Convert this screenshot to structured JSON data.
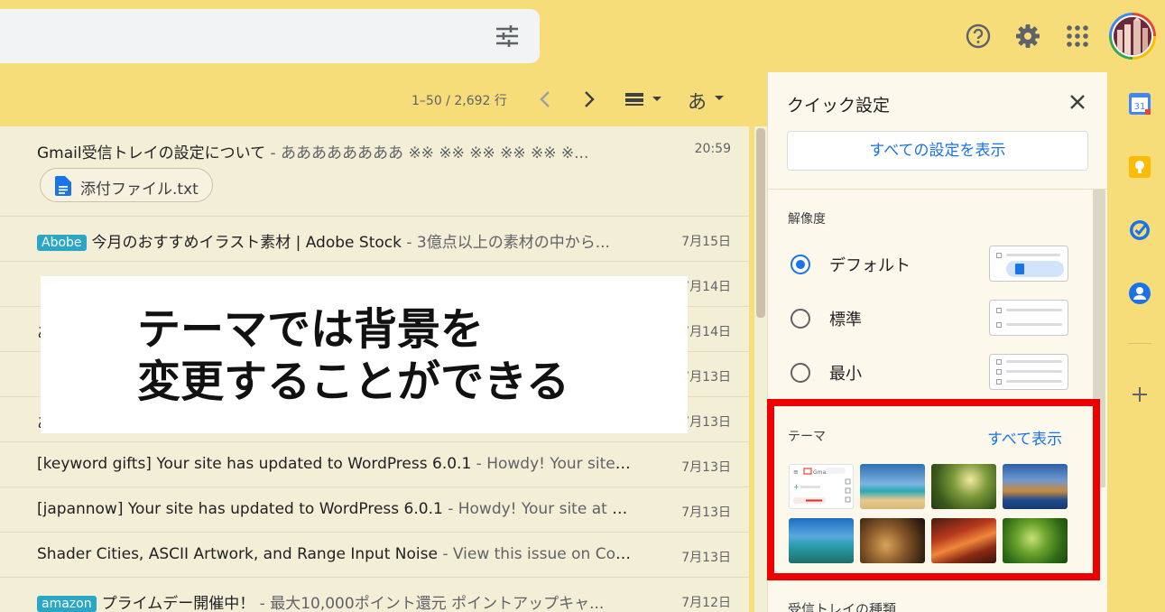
{
  "search": {
    "placeholder": "",
    "options_icon": "tune-icon"
  },
  "header_icons": [
    "help-icon",
    "settings-gear-icon",
    "apps-grid-icon",
    "account-avatar"
  ],
  "toolbar": {
    "pagination": "1–50 / 2,692 行",
    "input_tools_label": "あ"
  },
  "mails": [
    {
      "label": "",
      "subject": "Gmail受信トレイの設定について",
      "snippet": " - ああああああああ ※※ ※※ ※※ ※※ ※※ ※...",
      "date": "20:59",
      "attachment": "添付ファイル.txt"
    },
    {
      "label": "Abobe",
      "subject": "今月のおすすめイラスト素材 | Adobe Stock",
      "snippet": " - 3億点以上の素材の中から...",
      "date": "7月15日"
    },
    {
      "label": "",
      "subject": "",
      "snippet": "",
      "date": "7月14日"
    },
    {
      "label": "",
      "subject": "あ",
      "snippet": "",
      "date": "7月14日"
    },
    {
      "label": "",
      "subject": "",
      "snippet": "",
      "date": "7月13日"
    },
    {
      "label": "",
      "subject": "あ",
      "snippet": "",
      "date": "7月13日"
    },
    {
      "label": "",
      "subject": "[keyword gifts] Your site has updated to WordPress 6.0.1",
      "snippet": " - Howdy! Your site at h...",
      "date": "7月13日"
    },
    {
      "label": "",
      "subject": "[japannow] Your site has updated to WordPress 6.0.1",
      "snippet": " - Howdy! Your site at http:/...",
      "date": "7月13日"
    },
    {
      "label": "",
      "subject": "Shader Cities, ASCII Artwork, and Range Input Noise",
      "snippet": " - View this issue on CodeP...",
      "date": "7月13日"
    },
    {
      "label": "amazon",
      "subject": "プライムデー開催中！",
      "snippet": " - 最大10,000ポイント還元 ポイントアップキャ...",
      "date": "7月12日"
    }
  ],
  "caption": {
    "text": "テーマでは背景を\n変更することができる"
  },
  "quick_settings": {
    "title": "クイック設定",
    "all_settings_button": "すべての設定を表示",
    "density_title": "解像度",
    "density_options": [
      {
        "label": "デフォルト",
        "selected": true
      },
      {
        "label": "標準",
        "selected": false
      },
      {
        "label": "最小",
        "selected": false
      }
    ],
    "theme_title": "テーマ",
    "theme_view_all": "すべて表示",
    "theme_thumbnails": [
      "Gmail default",
      "beach",
      "forest",
      "coast",
      "lake",
      "chess",
      "canyon",
      "leaf"
    ],
    "next_section": "受信トレイの種類"
  },
  "side_panel": [
    "calendar-icon",
    "keep-icon",
    "tasks-icon",
    "contacts-icon",
    "add-icon"
  ],
  "colors": {
    "accent": "#1a73e8",
    "header_bg": "#f7dc7a",
    "highlight_frame": "#ee0000",
    "label_bg": "#2aa6c6"
  }
}
